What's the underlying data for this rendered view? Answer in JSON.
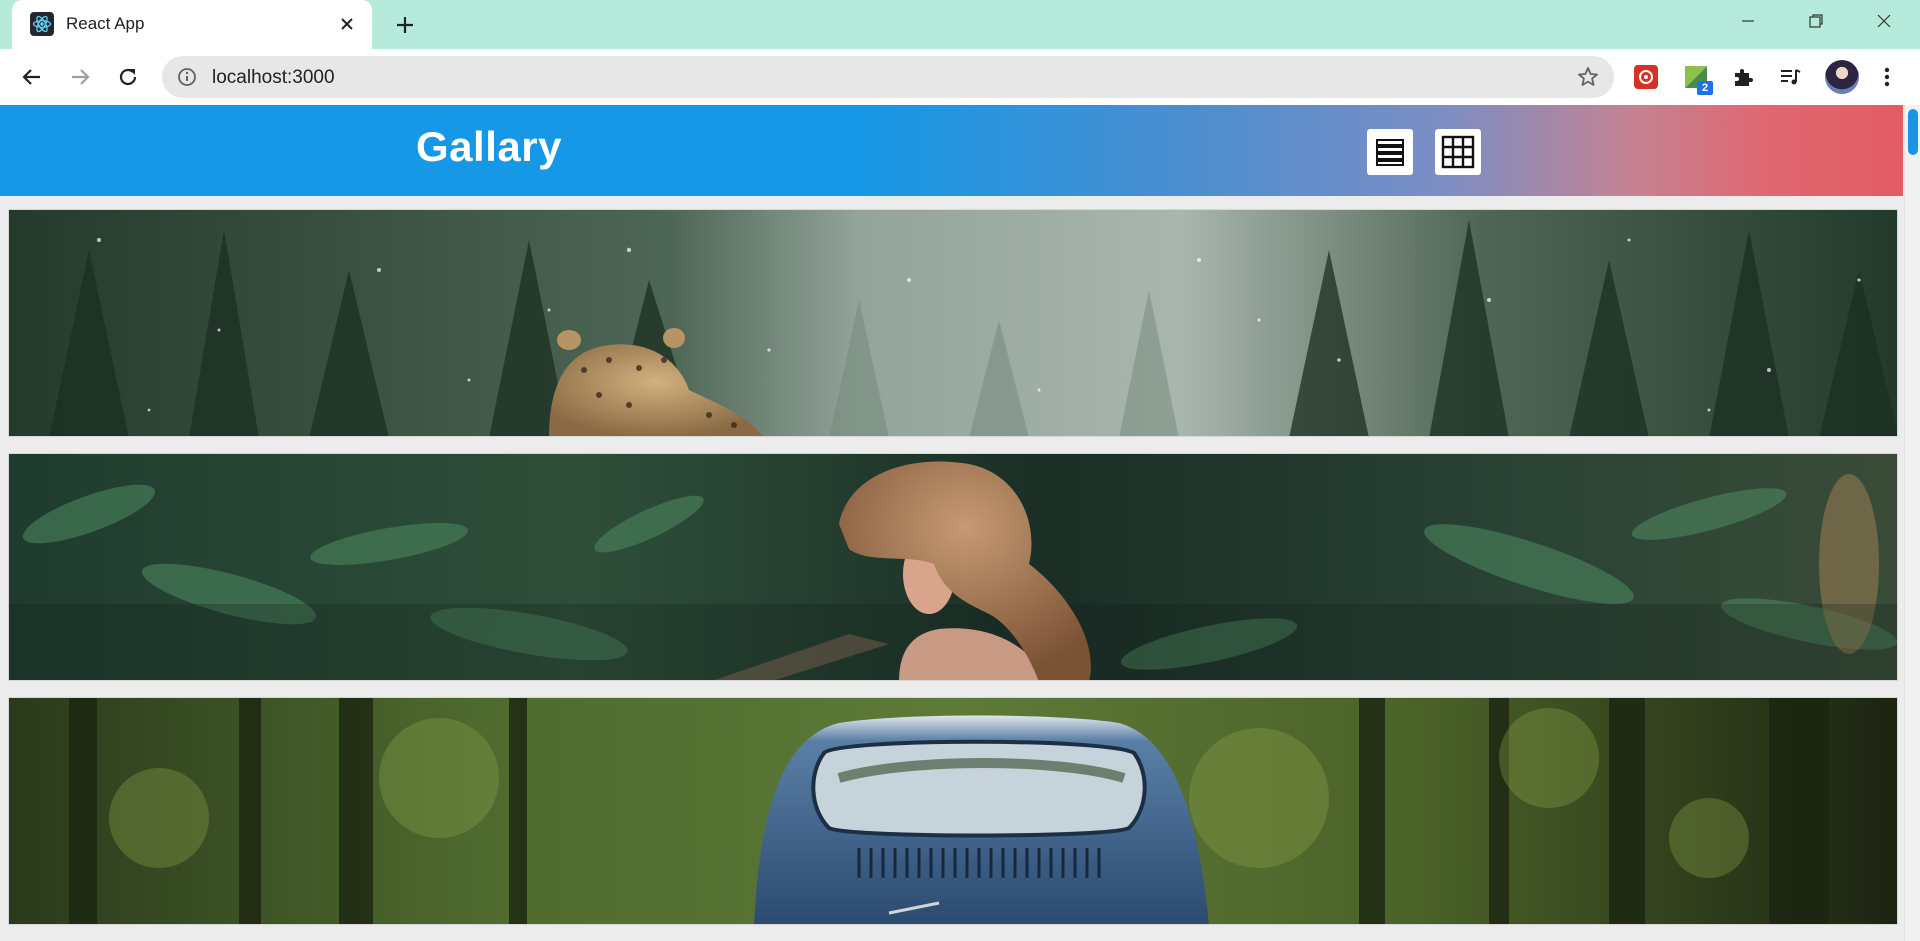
{
  "browser": {
    "tab_title": "React App",
    "url": "localhost:3000",
    "extension_badge_count": "2"
  },
  "app": {
    "title": "Gallary",
    "view_modes": [
      "list-icon",
      "grid-icon"
    ]
  },
  "gallery": {
    "images": [
      "leopard in snowy forest",
      "woman with ponytail in forest",
      "blue vintage car in forest"
    ]
  }
}
